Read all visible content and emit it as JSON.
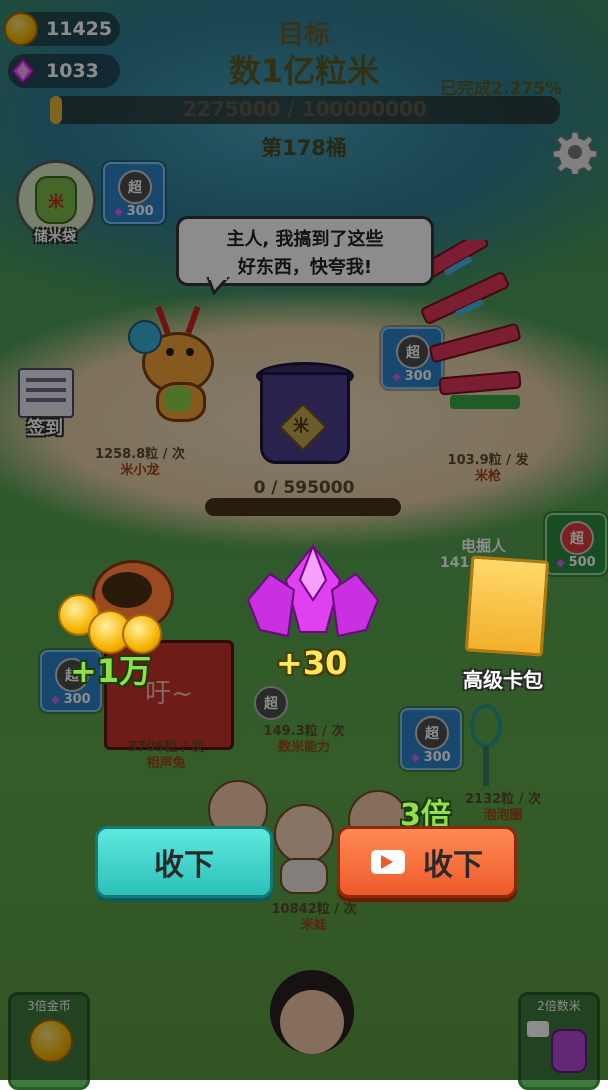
{
  "currency": {
    "coins": "11425",
    "gems": "1033"
  },
  "goal": {
    "title": "目标",
    "subtitle": "数1亿粒米",
    "completed": "已完成2.275%",
    "progress_text": "2275000 / 100000000",
    "progress_fraction": 0.02275,
    "bucket": "第178桶"
  },
  "left_menu": {
    "rice_bag_label": "储米袋",
    "checkin_label": "签到"
  },
  "speech": {
    "line1": "主人, 我搞到了这些",
    "line2": "好东西，快夸我!"
  },
  "upgrade_lock": {
    "super": "超",
    "cost": "300"
  },
  "upgrade_lock_green": {
    "super": "超",
    "cost": "500"
  },
  "barrel": {
    "progress_text": "0 / 595000",
    "progress_fraction": 0
  },
  "units": [
    {
      "rate": "1258.8粒 / 次",
      "name": "米小龙"
    },
    {
      "rate": "103.9粒 / 发",
      "name": "米枪"
    },
    {
      "rate": "3705粒 / 次",
      "name": "相声兔"
    },
    {
      "rate": "149.3粒 / 次",
      "name": "数米能力"
    },
    {
      "rate": "2132粒 / 次",
      "name": "泡泡圈"
    },
    {
      "rate": "10842粒 / 次",
      "name": "米娃"
    }
  ],
  "miner": {
    "label": "电掘人",
    "partial_count": "141."
  },
  "rewards": {
    "coins_amount": "+1万",
    "gems_amount": "+30",
    "card_pack_label": "高级卡包"
  },
  "rabbit_text": "吁~",
  "small_super": "超",
  "multiplier": "3倍",
  "buttons": {
    "collect": "收下",
    "collect_video": "收下"
  },
  "bottom": {
    "left_label": "3倍金币",
    "right_label": "2倍数米"
  },
  "colors": {
    "teal_button": "#3ad0c8",
    "orange_button": "#f26b3a",
    "gem_purple": "#d53fe6",
    "coin_gold": "#f6b400",
    "green_text": "#8fe04a"
  }
}
